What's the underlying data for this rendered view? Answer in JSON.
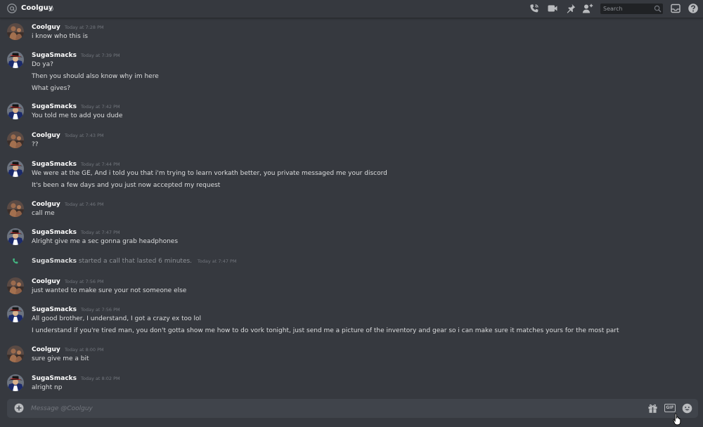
{
  "header": {
    "channel_name": "Coolguy",
    "search_placeholder": "Search"
  },
  "messages": [
    {
      "author": "Coolguy",
      "timestamp": "Today at 7:28 PM",
      "avatar": "coolguy",
      "lines": [
        "i know who this is"
      ]
    },
    {
      "author": "SugaSmacks",
      "timestamp": "Today at 7:39 PM",
      "avatar": "sugasmacks",
      "lines": [
        "Do ya?",
        "Then you should also know why im here",
        "What gives?"
      ]
    },
    {
      "author": "SugaSmacks",
      "timestamp": "Today at 7:42 PM",
      "avatar": "sugasmacks",
      "lines": [
        "You told me to add you dude"
      ]
    },
    {
      "author": "Coolguy",
      "timestamp": "Today at 7:43 PM",
      "avatar": "coolguy",
      "lines": [
        "??"
      ]
    },
    {
      "author": "SugaSmacks",
      "timestamp": "Today at 7:44 PM",
      "avatar": "sugasmacks",
      "lines": [
        "We were at the GE, And i told you that i'm trying to learn vorkath better, you private messaged me your discord",
        "It's been a few days and you just now accepted my request"
      ]
    },
    {
      "author": "Coolguy",
      "timestamp": "Today at 7:46 PM",
      "avatar": "coolguy",
      "lines": [
        "call me"
      ]
    },
    {
      "author": "SugaSmacks",
      "timestamp": "Today at 7:47 PM",
      "avatar": "sugasmacks",
      "lines": [
        "Alright give me a sec gonna grab headphones"
      ]
    },
    {
      "author": "Coolguy",
      "timestamp": "Today at 7:56 PM",
      "avatar": "coolguy",
      "lines": [
        "just wanted to make sure your not someone else"
      ]
    },
    {
      "author": "SugaSmacks",
      "timestamp": "Today at 7:56 PM",
      "avatar": "sugasmacks",
      "lines": [
        "All good brother, I understand, I got a crazy ex too lol",
        "I understand if you're tired man, you don't gotta show me how to do vork tonight, just send me a picture of the inventory and gear so i can make sure it matches yours for the most part"
      ]
    },
    {
      "author": "Coolguy",
      "timestamp": "Today at 8:00 PM",
      "avatar": "coolguy",
      "lines": [
        "sure give me a bit"
      ]
    },
    {
      "author": "SugaSmacks",
      "timestamp": "Today at 8:02 PM",
      "avatar": "sugasmacks",
      "lines": [
        "alright np"
      ]
    }
  ],
  "call_event": {
    "user": "SugaSmacks",
    "text": "started a call that lasted 6 minutes.",
    "timestamp": "Today at 7:47 PM"
  },
  "composer": {
    "placeholder": "Message @Coolguy",
    "gif_label": "GIF"
  },
  "colors": {
    "background": "#36393f",
    "composer": "#40444b",
    "search": "#202225",
    "username": "#ffffff",
    "text": "#dcddde",
    "muted": "#72767d",
    "call_icon": "#43b581"
  }
}
